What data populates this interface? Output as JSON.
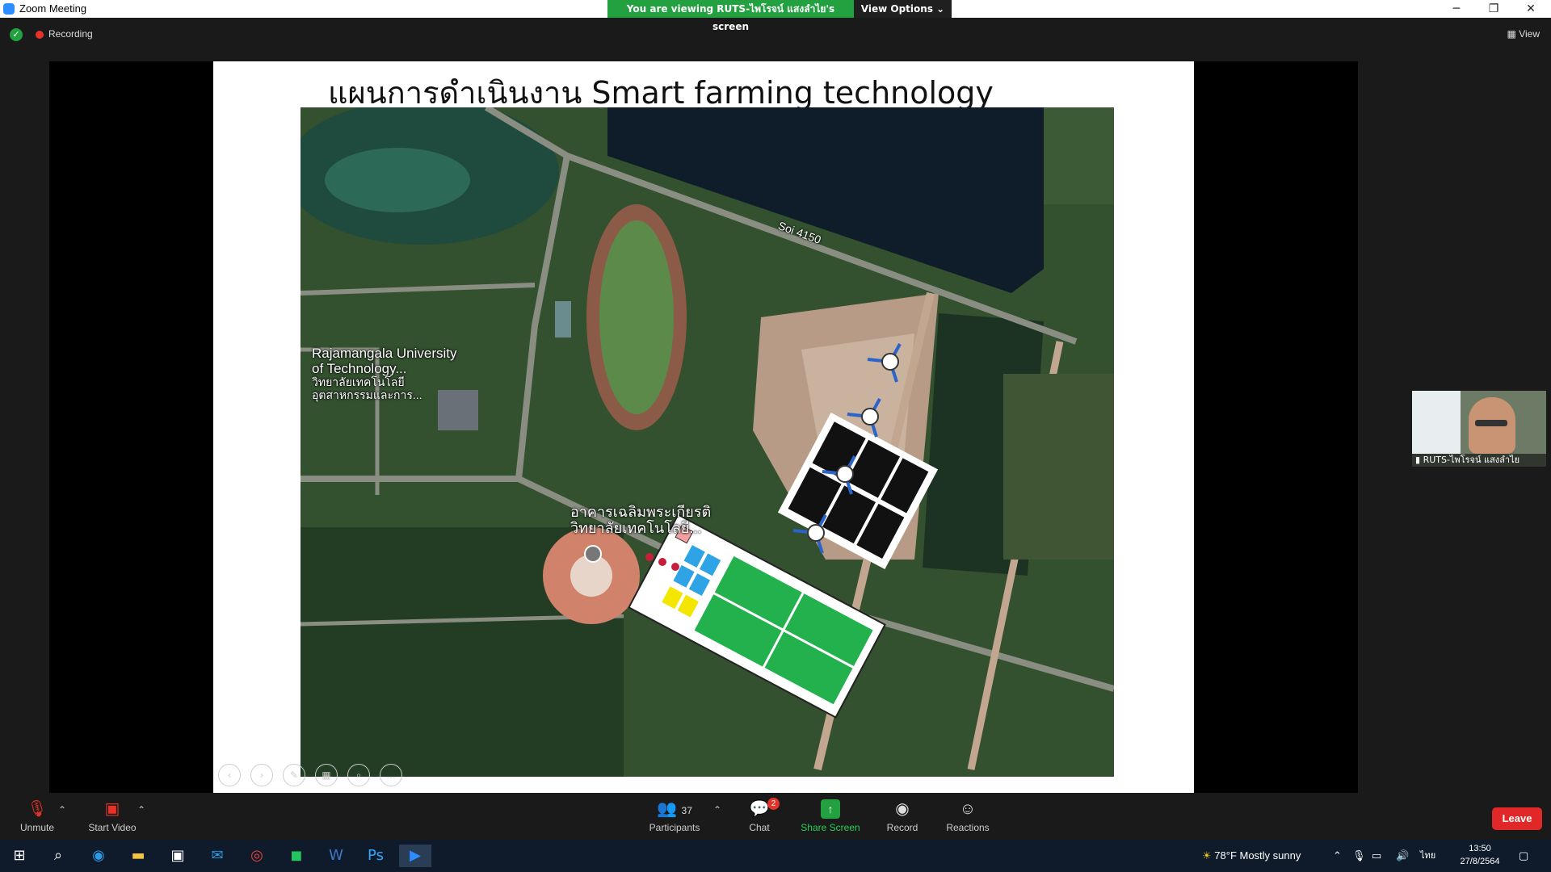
{
  "window": {
    "title": "Zoom Meeting",
    "minimize": "─",
    "restore": "❐",
    "close": "✕"
  },
  "banner": {
    "viewing_text": "You are viewing RUTS-ไพโรจน์ แสงลำไย's screen",
    "view_options_label": "View Options ⌄"
  },
  "status": {
    "recording_label": "Recording",
    "view_label": "View",
    "security_icon": "shield-check-icon"
  },
  "slide": {
    "title": "แผนการดำเนินงาน Smart farming technology",
    "map": {
      "road_label": "Soi 4150",
      "poi1_line1": "Rajamangala University",
      "poi1_line2": "of Technology...",
      "poi1_line3": "วิทยาลัยเทคโนโลยี",
      "poi1_line4": "อุตสาหกรรมและการ...",
      "poi2_line1": "อาคารเฉลิมพระเกียรติ",
      "poi2_line2": "วิทยาลัยเทคโนโลยี..."
    }
  },
  "participant": {
    "name": "RUTS-ไพโรจน์ แสงลำไย"
  },
  "toolbar": {
    "unmute": "Unmute",
    "start_video": "Start Video",
    "participants": "Participants",
    "participants_count": "37",
    "chat": "Chat",
    "chat_badge": "2",
    "share_screen": "Share Screen",
    "record": "Record",
    "reactions": "Reactions",
    "leave": "Leave"
  },
  "taskbar": {
    "weather": "78°F  Mostly sunny",
    "language": "ไทย",
    "time": "13:50",
    "date": "27/8/2564"
  },
  "colors": {
    "share_green": "#23a040",
    "leave_red": "#e02828",
    "zoom_blue": "#2d8cff"
  }
}
